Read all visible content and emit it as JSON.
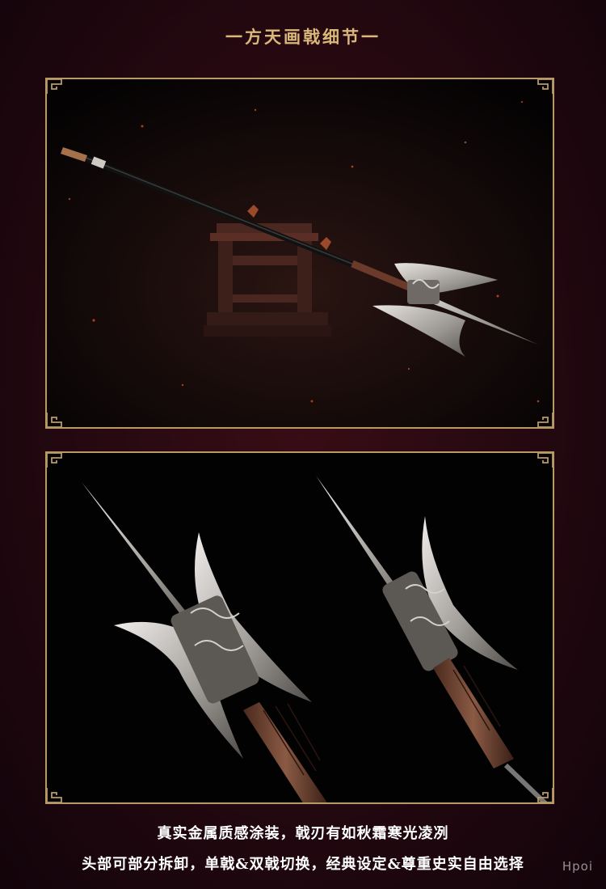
{
  "section": {
    "title": "一方天画戟细节一"
  },
  "images": [
    {
      "subject": "halberd-on-stand-photo"
    },
    {
      "subject": "halberd-head-closeup-photo"
    }
  ],
  "captions": {
    "line1": "真实金属质感涂装，戟刃有如秋霜寒光凌冽",
    "line2": "头部可部分拆卸，单戟&双戟切换，经典设定&尊重史实自由选择"
  },
  "watermark": "Hpoi",
  "colors": {
    "background": "#240810",
    "title": "#d9b87a",
    "frame": "#b99a67",
    "caption": "#ffffff"
  }
}
